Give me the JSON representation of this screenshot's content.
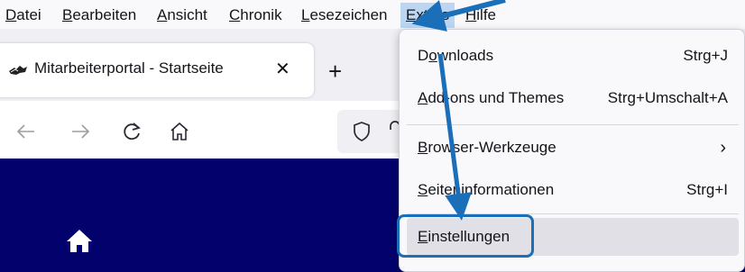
{
  "menubar": {
    "items": [
      "Datei",
      "Bearbeiten",
      "Ansicht",
      "Chronik",
      "Lesezeichen",
      "Extras",
      "Hilfe"
    ],
    "active": "Extras"
  },
  "tab": {
    "title": "Mitarbeiterportal - Startseite",
    "close_icon": "close-icon",
    "new_tab_icon": "plus-icon"
  },
  "nav": {
    "icons": [
      "back-arrow-icon",
      "forward-arrow-icon",
      "reload-icon",
      "home-icon",
      "shield-icon",
      "lock-icon"
    ]
  },
  "dropdown": {
    "items": [
      {
        "label_u": "o",
        "label_pre": "D",
        "label_post": "wnloads",
        "shortcut": "Strg+J"
      },
      {
        "label_pre": "",
        "label_u": "A",
        "label_post": "dd-ons und Themes",
        "shortcut": "Strg+Umschalt+A"
      },
      {
        "label_pre": "",
        "label_u": "B",
        "label_post": "rowser-Werkzeuge",
        "submenu": "chevron-right-icon"
      },
      {
        "label_pre": "",
        "label_u": "S",
        "label_post": "eiteninformationen",
        "shortcut": "Strg+I"
      },
      {
        "label_pre": "",
        "label_u": "E",
        "label_post": "instellungen"
      }
    ]
  },
  "colors": {
    "accent_arrow": "#1a6fb8",
    "page_background": "#03026c",
    "menu_active": "#bcd6f2"
  }
}
